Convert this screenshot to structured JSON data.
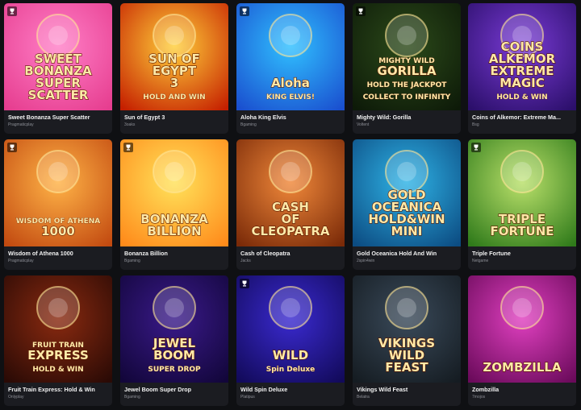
{
  "games": [
    {
      "title": "Sweet Bonanza Super Scatter",
      "provider": "Pragmaticplay",
      "art_text": [
        "SWEET",
        "BONANZA",
        "SUPER",
        "SCATTER"
      ],
      "trophy": true,
      "bg": [
        "#ff7fc7",
        "#e63d8f"
      ],
      "icon": "candy-icon"
    },
    {
      "title": "Sun of Egypt 3",
      "provider": "3oaks",
      "art_text": [
        "SUN OF",
        "EGYPT",
        "3",
        "HOLD AND WIN"
      ],
      "trophy": false,
      "bg": [
        "#ffcf3a",
        "#c51f00"
      ],
      "icon": "sun-icon"
    },
    {
      "title": "Aloha King Elvis",
      "provider": "Bgaming",
      "art_text": [
        "Aloha",
        "KING ELVIS!"
      ],
      "trophy": true,
      "bg": [
        "#30c0ff",
        "#1a4fcf"
      ],
      "icon": "frog-icon"
    },
    {
      "title": "Mighty Wild: Gorilla",
      "provider": "Voltent",
      "art_text": [
        "MIGHTY WILD",
        "GORILLA",
        "HOLD THE JACKPOT",
        "COLLECT TO INFINITY"
      ],
      "trophy": true,
      "bg": [
        "#2c4a1a",
        "#0d1a08"
      ],
      "icon": "gorilla-icon"
    },
    {
      "title": "Coins of Alkemor: Extreme Ma...",
      "provider": "Bsg",
      "art_text": [
        "COINS",
        "ALKEMOR",
        "EXTREME",
        "MAGIC",
        "HOLD & WIN"
      ],
      "trophy": false,
      "bg": [
        "#7a3bd6",
        "#2b0f6a"
      ],
      "icon": "wizard-icon"
    },
    {
      "title": "Wisdom of Athena 1000",
      "provider": "Pragmaticplay",
      "art_text": [
        "WISDOM OF ATHENA",
        "1000"
      ],
      "trophy": true,
      "bg": [
        "#ffb347",
        "#c24a10"
      ],
      "icon": "athena-icon"
    },
    {
      "title": "Bonanza Billion",
      "provider": "Bgaming",
      "art_text": [
        "BONANZA",
        "BILLION"
      ],
      "trophy": true,
      "bg": [
        "#ffe25a",
        "#ff8a1a"
      ],
      "icon": "gems-icon"
    },
    {
      "title": "Cash of Cleopatra",
      "provider": "Jacks",
      "art_text": [
        "CASH",
        "OF",
        "CLEOPATRA"
      ],
      "trophy": false,
      "bg": [
        "#f0883a",
        "#7a2a08"
      ],
      "icon": "cleopatra-icon"
    },
    {
      "title": "Gold Oceanica Hold And Win",
      "provider": "2spin4win",
      "art_text": [
        "GOLD",
        "OCEANICA",
        "HOLD&WIN",
        "MINI"
      ],
      "trophy": false,
      "bg": [
        "#2fb3e6",
        "#0c4c82"
      ],
      "icon": "statue-icon"
    },
    {
      "title": "Triple Fortune",
      "provider": "Netgame",
      "art_text": [
        "TRIPLE",
        "FORTUNE"
      ],
      "trophy": true,
      "bg": [
        "#b9e06a",
        "#2f7a1a"
      ],
      "icon": "coin-icon"
    },
    {
      "title": "Fruit Train Express: Hold & Win",
      "provider": "Onlyplay",
      "art_text": [
        "FRUIT TRAIN",
        "EXPRESS",
        "HOLD & WIN"
      ],
      "trophy": false,
      "bg": [
        "#8a2a10",
        "#2a0a05"
      ],
      "icon": "train-icon"
    },
    {
      "title": "Jewel Boom Super Drop",
      "provider": "Bgaming",
      "art_text": [
        "JEWEL",
        "BOOM",
        "SUPER DROP"
      ],
      "trophy": false,
      "bg": [
        "#3a1a8a",
        "#12063a"
      ],
      "icon": "jewel-icon"
    },
    {
      "title": "Wild Spin Deluxe",
      "provider": "Platipus",
      "art_text": [
        "WILD",
        "Spin Deluxe"
      ],
      "trophy": true,
      "bg": [
        "#3a2ad0",
        "#120a5a"
      ],
      "icon": "cherry-icon"
    },
    {
      "title": "Vikings Wild Feast",
      "provider": "Belatra",
      "art_text": [
        "VIKINGS",
        "WILD",
        "FEAST"
      ],
      "trophy": false,
      "bg": [
        "#3a4a5a",
        "#151c22"
      ],
      "icon": "viking-icon"
    },
    {
      "title": "Zombzilla",
      "provider": "7mojos",
      "art_text": [
        "ZOMBZILLA"
      ],
      "trophy": false,
      "bg": [
        "#e040c0",
        "#6a0a5a"
      ],
      "icon": "zombie-icon"
    }
  ]
}
